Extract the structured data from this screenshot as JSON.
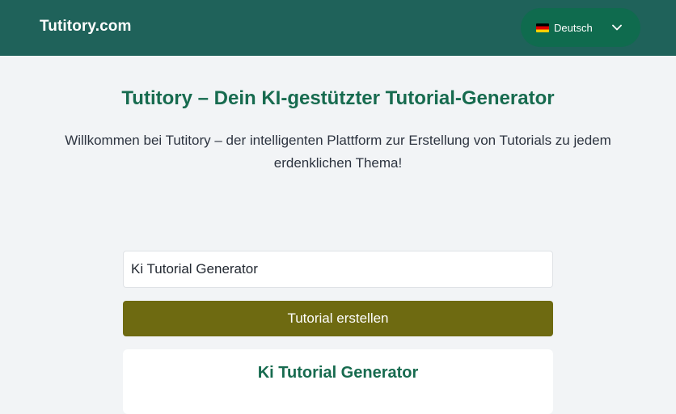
{
  "header": {
    "brand": "Tutitory.com",
    "language": {
      "label": "Deutsch",
      "flag_icon": "german-flag-icon",
      "chevron_icon": "chevron-down-icon"
    }
  },
  "main": {
    "title": "Tutitory – Dein KI-gestützter Tutorial-Generator",
    "intro": "Willkommen bei Tutitory – der intelligenten Plattform zur Erstellung von Tutorials zu jedem erdenklichen Thema!",
    "topic_input": {
      "value": "Ki Tutorial Generator"
    },
    "create_button": "Tutorial erstellen",
    "result": {
      "title": "Ki Tutorial Generator"
    }
  },
  "colors": {
    "header_bg": "#1f625a",
    "language_button_bg": "#0f6b4e",
    "accent_green": "#176b4f",
    "button_bg": "#6e6a11",
    "page_bg": "#f2f4f6"
  }
}
